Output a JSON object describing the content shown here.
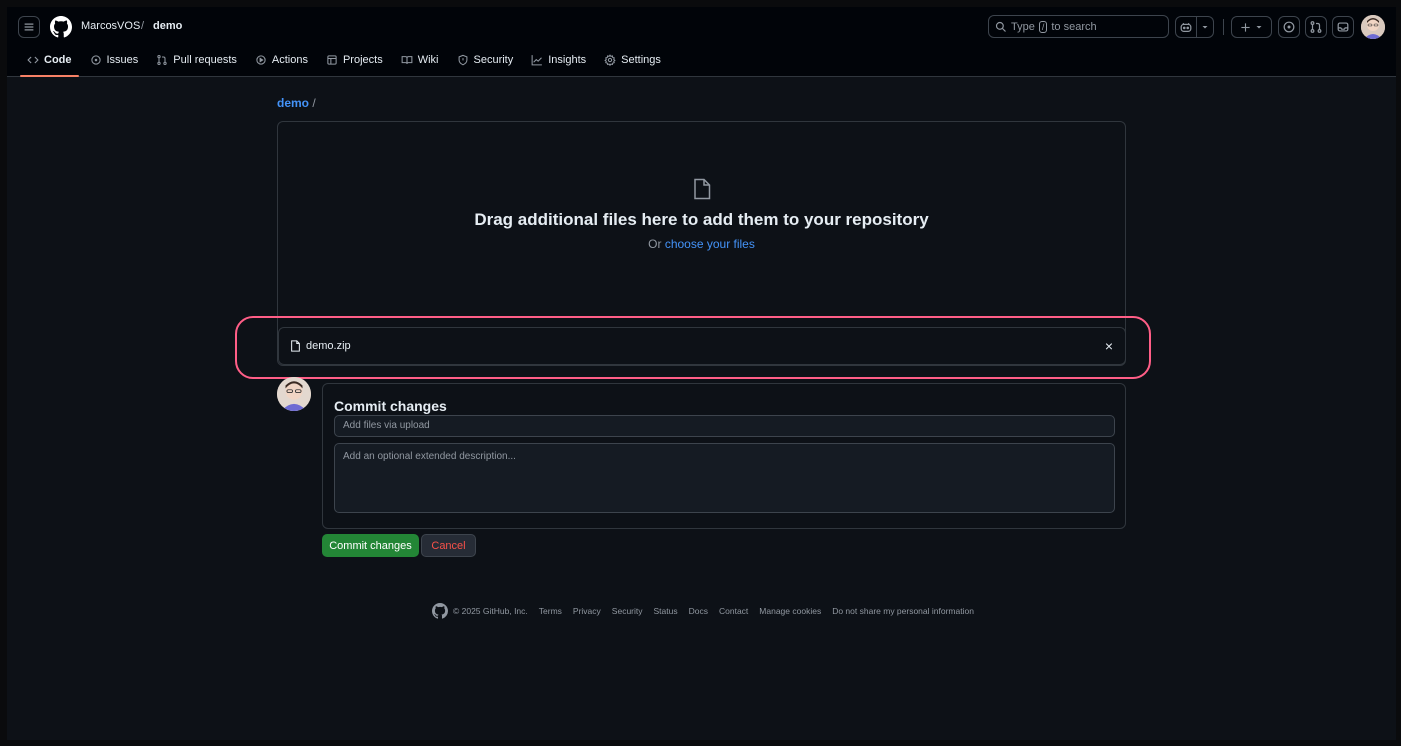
{
  "header": {
    "owner": "MarcosVOS",
    "separator": "/",
    "repo": "demo",
    "search_prefix": "Type",
    "search_key": "/",
    "search_suffix": "to search"
  },
  "tabs": [
    {
      "label": "Code",
      "icon": "code-icon",
      "active": true
    },
    {
      "label": "Issues",
      "icon": "issue-icon"
    },
    {
      "label": "Pull requests",
      "icon": "pull-request-icon"
    },
    {
      "label": "Actions",
      "icon": "play-icon"
    },
    {
      "label": "Projects",
      "icon": "table-icon"
    },
    {
      "label": "Wiki",
      "icon": "book-icon"
    },
    {
      "label": "Security",
      "icon": "shield-icon"
    },
    {
      "label": "Insights",
      "icon": "graph-icon"
    },
    {
      "label": "Settings",
      "icon": "gear-icon"
    }
  ],
  "breadcrumb": {
    "repo": "demo",
    "sep": "/"
  },
  "dropzone": {
    "title": "Drag additional files here to add them to your repository",
    "prefix": "Or",
    "link": "choose your files"
  },
  "file": {
    "name": "demo.zip",
    "remove": "×"
  },
  "commit": {
    "title": "Commit changes",
    "summary_placeholder": "Add files via upload",
    "description_placeholder": "Add an optional extended description...",
    "commit_button": "Commit changes",
    "cancel_button": "Cancel"
  },
  "footer": {
    "copyright": "© 2025 GitHub, Inc.",
    "links": [
      "Terms",
      "Privacy",
      "Security",
      "Status",
      "Docs",
      "Contact",
      "Manage cookies",
      "Do not share my personal information"
    ]
  },
  "colors": {
    "accent_link": "#4493f8",
    "primary_button": "#238636",
    "highlight_annotation": "#ff5e87",
    "active_tab_underline": "#f78166"
  }
}
